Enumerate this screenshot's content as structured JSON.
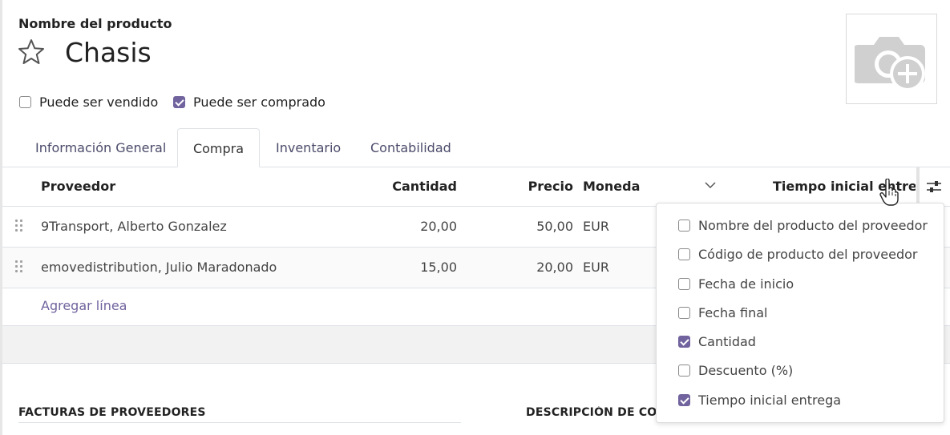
{
  "product": {
    "name_label": "Nombre del producto",
    "name": "Chasis"
  },
  "options": {
    "can_be_sold": {
      "label": "Puede ser vendido",
      "checked": false
    },
    "can_be_purchased": {
      "label": "Puede ser comprado",
      "checked": true
    }
  },
  "tabs": [
    {
      "label": "Información General",
      "active": false
    },
    {
      "label": "Compra",
      "active": true
    },
    {
      "label": "Inventario",
      "active": false
    },
    {
      "label": "Contabilidad",
      "active": false
    }
  ],
  "vendor_table": {
    "headers": {
      "vendor": "Proveedor",
      "quantity": "Cantidad",
      "price": "Precio",
      "currency": "Moneda",
      "lead_time": "Tiempo inicial entrega"
    },
    "rows": [
      {
        "vendor": "9Transport, Alberto Gonzalez",
        "quantity": "20,00",
        "price": "50,00",
        "currency": "EUR"
      },
      {
        "vendor": "emovedistribution, Julio Maradonado",
        "quantity": "15,00",
        "price": "20,00",
        "currency": "EUR"
      }
    ],
    "add_line": "Agregar línea"
  },
  "sections": {
    "vendor_bills": "FACTURAS DE PROVEEDORES",
    "description": "DESCRIPCIÓN DE COMPRA"
  },
  "column_selector": {
    "items": [
      {
        "label": "Nombre del producto del proveedor",
        "checked": false
      },
      {
        "label": "Código de producto del proveedor",
        "checked": false
      },
      {
        "label": "Fecha de inicio",
        "checked": false
      },
      {
        "label": "Fecha final",
        "checked": false
      },
      {
        "label": "Cantidad",
        "checked": true
      },
      {
        "label": "Descuento (%)",
        "checked": false
      },
      {
        "label": "Tiempo inicial entrega",
        "checked": true
      }
    ]
  },
  "colors": {
    "accent": "#71639e",
    "border": "#dee2e6",
    "band": "#f2f2f2"
  }
}
